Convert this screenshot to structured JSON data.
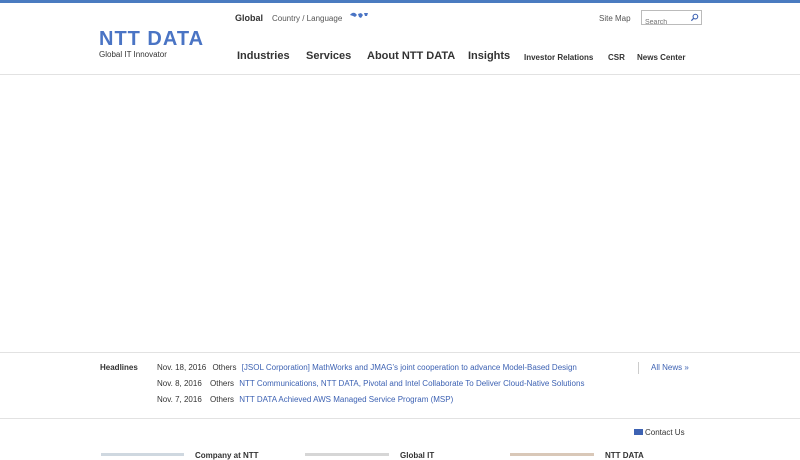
{
  "header": {
    "logo_main": "NTT DATA",
    "logo_sub": "Global IT Innovator",
    "global_label": "Global",
    "country_language": "Country / Language",
    "site_map": "Site Map",
    "search_placeholder": "Search"
  },
  "nav": {
    "items": [
      {
        "label": "Industries"
      },
      {
        "label": "Services"
      },
      {
        "label": "About NTT DATA"
      },
      {
        "label": "Insights"
      },
      {
        "label": "Investor Relations"
      },
      {
        "label": "CSR"
      },
      {
        "label": "News Center"
      }
    ]
  },
  "headlines": {
    "title": "Headlines",
    "all_news": "All News »",
    "items": [
      {
        "date": "Nov. 18, 2016",
        "category": "Others",
        "text": "[JSOL Corporation] MathWorks and JMAG’s joint cooperation to advance Model-Based Design"
      },
      {
        "date": "Nov. 8, 2016",
        "category": "Others",
        "text": "NTT Communications, NTT DATA, Pivotal and Intel Collaborate To Deliver Cloud-Native Solutions"
      },
      {
        "date": "Nov. 7, 2016",
        "category": "Others",
        "text": "NTT DATA Achieved AWS Managed Service Program (MSP)"
      }
    ]
  },
  "footer": {
    "contact_us": "Contact Us",
    "tiles": [
      {
        "label": "Company at NTT"
      },
      {
        "label": "Global IT"
      },
      {
        "label": "NTT DATA"
      }
    ]
  },
  "colors": {
    "brand": "#4a74c4",
    "link": "#3d62b3"
  }
}
